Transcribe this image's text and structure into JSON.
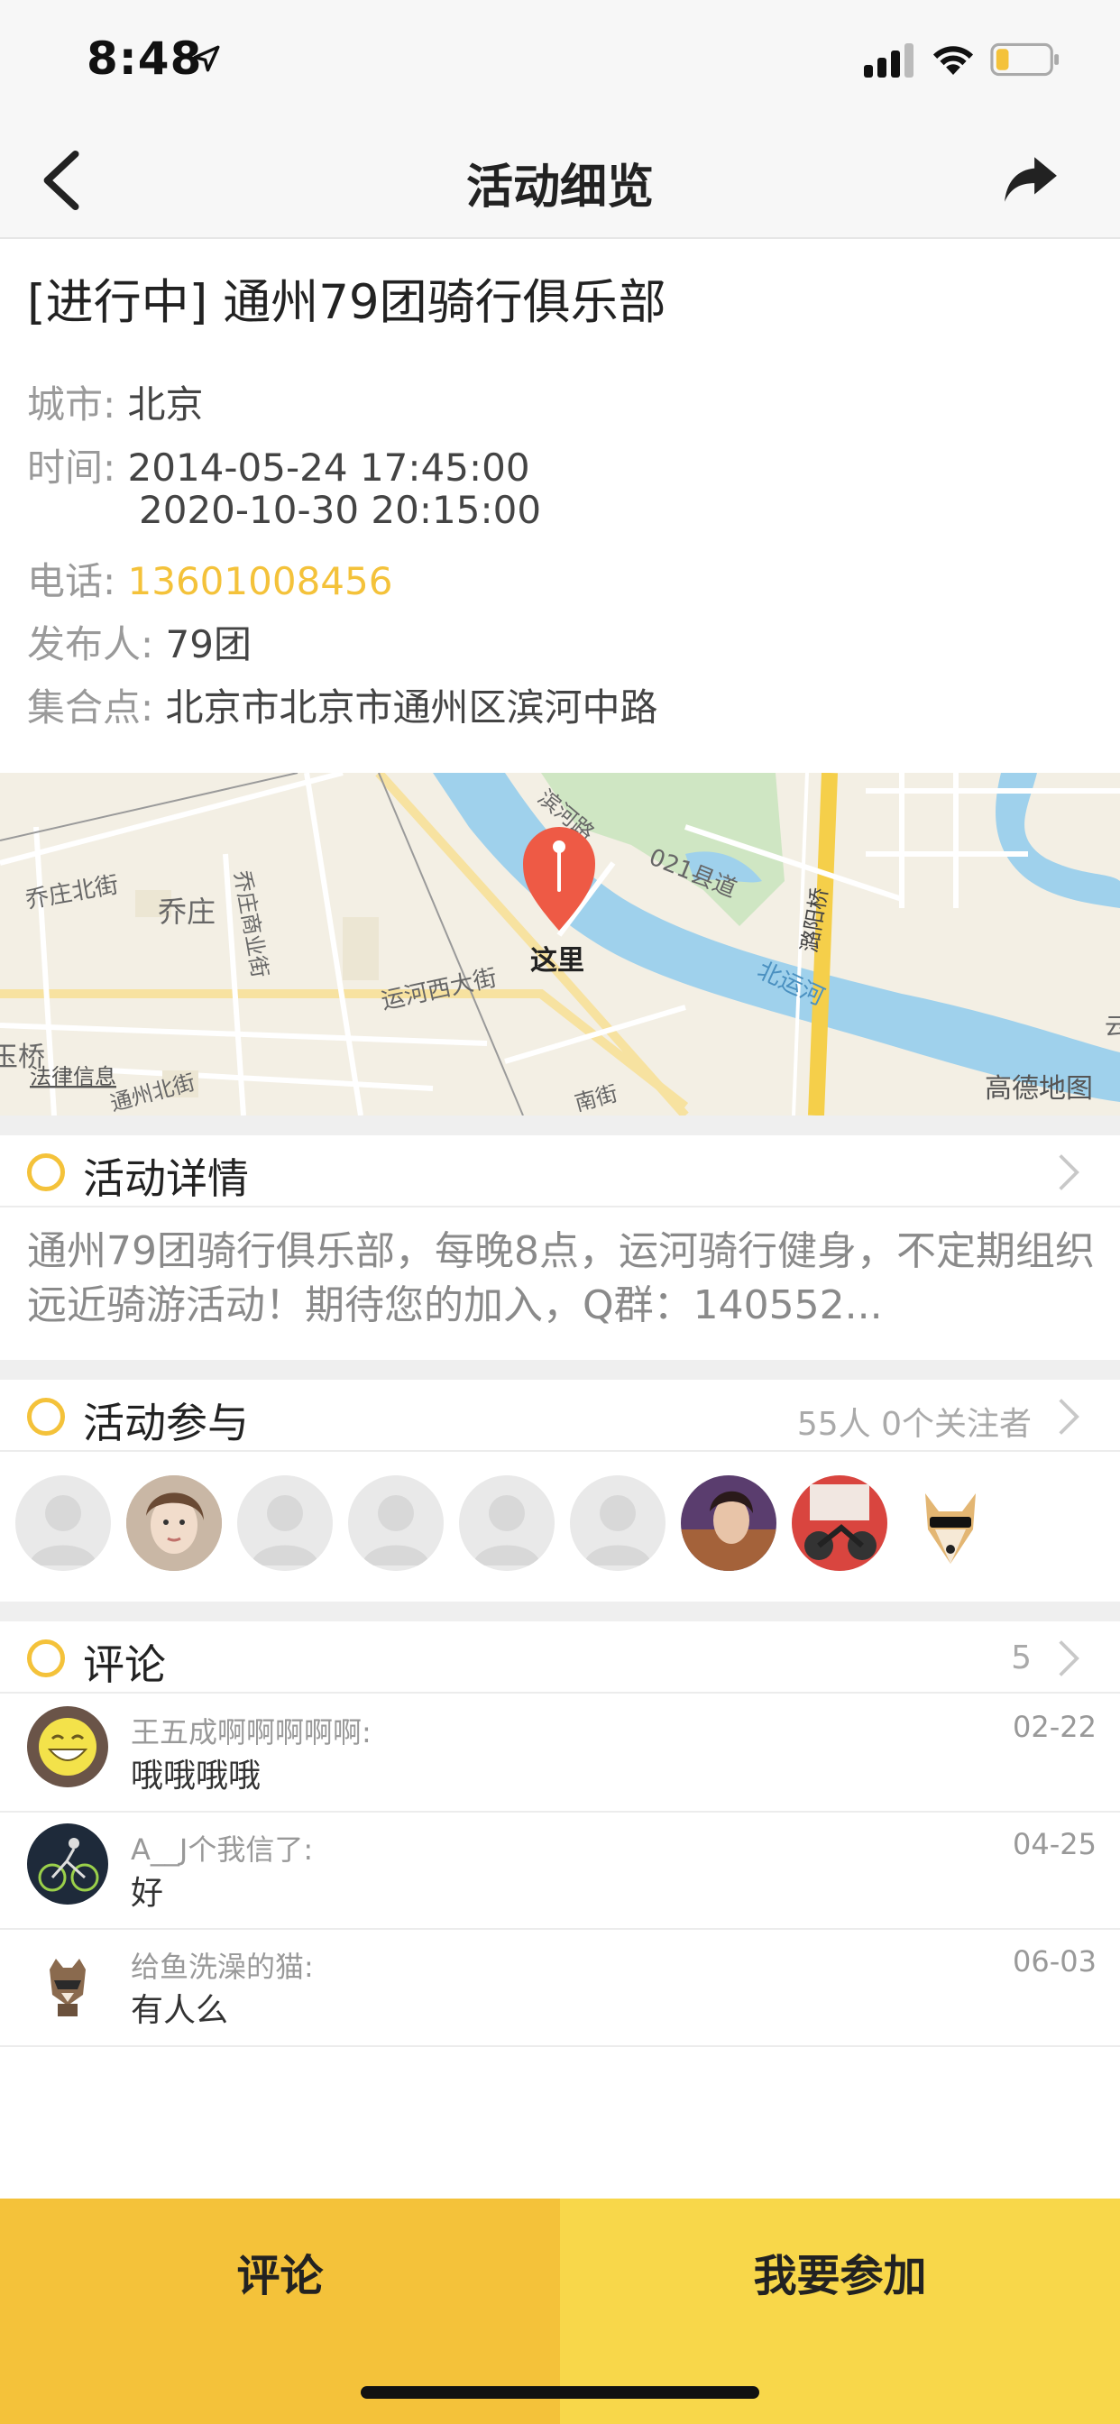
{
  "status_bar": {
    "time": "8:48"
  },
  "nav": {
    "title": "活动细览"
  },
  "event": {
    "title": "[进行中] 通州79团骑行俱乐部",
    "city_label": "城市:",
    "city": "北京",
    "time_label": "时间:",
    "time_start": "2014-05-24 17:45:00",
    "time_end": "2020-10-30 20:15:00",
    "phone_label": "电话:",
    "phone": "13601008456",
    "publisher_label": "发布人:",
    "publisher": "79团",
    "meeting_label": "集合点:",
    "meeting_point": "北京市北京市通州区滨河中路"
  },
  "map": {
    "marker_label": "这里",
    "attribution": "高德地图",
    "legal": "法律信息",
    "places": [
      "乔庄北街",
      "乔庄",
      "乔庄商业街",
      "运河西大街",
      "021县道",
      "北运河",
      "潞阳桥",
      "滨河路",
      "玉桥",
      "通州北街",
      "云",
      "南街"
    ]
  },
  "details": {
    "title": "活动详情",
    "text": "通州79团骑行俱乐部，每晚8点，运河骑行健身，不定期组织远近骑游活动！期待您的加入，Q群：140552..."
  },
  "participants": {
    "title": "活动参与",
    "summary": "55人 0个关注者",
    "avatars": [
      "default",
      "photo-girl",
      "default",
      "default",
      "default",
      "default",
      "photo-man",
      "photo-motorbike",
      "photo-dog-sunglasses"
    ]
  },
  "comments": {
    "title": "评论",
    "count": "5",
    "items": [
      {
        "name": "王五成啊啊啊啊啊:",
        "text": "哦哦哦哦",
        "date": "02-22",
        "avatar": "emoji-face"
      },
      {
        "name": "A__J个我信了:",
        "text": "好",
        "date": "04-25",
        "avatar": "cyclist"
      },
      {
        "name": "给鱼洗澡的猫:",
        "text": "有人么",
        "date": "06-03",
        "avatar": "raccoon"
      }
    ]
  },
  "actions": {
    "comment": "评论",
    "join": "我要参加"
  },
  "colors": {
    "accent": "#f4c23a",
    "accent_light": "#f8d74a"
  }
}
